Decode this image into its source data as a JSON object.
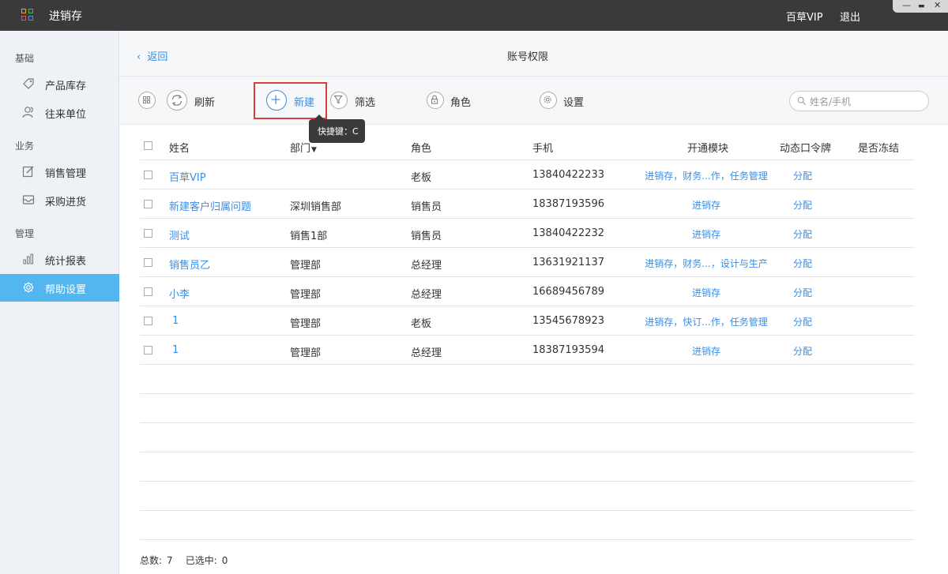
{
  "window": {
    "app_title": "进销存",
    "user": "百草VIP",
    "logout": "退出",
    "controls": {
      "minimize": "—",
      "maximize": "▬",
      "close": "✕"
    }
  },
  "sidebar": {
    "sections": [
      {
        "title": "基础",
        "items": [
          {
            "label": "产品库存",
            "icon": "tag-icon"
          },
          {
            "label": "往来单位",
            "icon": "contacts-icon"
          }
        ]
      },
      {
        "title": "业务",
        "items": [
          {
            "label": "销售管理",
            "icon": "edit-icon"
          },
          {
            "label": "采购进货",
            "icon": "inbox-icon"
          }
        ]
      },
      {
        "title": "管理",
        "items": [
          {
            "label": "统计报表",
            "icon": "bar-chart-icon"
          },
          {
            "label": "帮助设置",
            "icon": "gear-icon",
            "active": true
          }
        ]
      }
    ]
  },
  "header": {
    "back": "返回",
    "title": "账号权限"
  },
  "toolbar": {
    "refresh": "刷新",
    "create": "新建",
    "filter": "筛选",
    "role": "角色",
    "settings": "设置",
    "tooltip": "快捷键：C",
    "search_placeholder": "姓名/手机"
  },
  "table": {
    "headers": {
      "name": "姓名",
      "dept": "部门",
      "role": "角色",
      "phone": "手机",
      "modules": "开通模块",
      "token": "动态口令牌",
      "frozen": "是否冻结"
    },
    "sort_indicator": "▼",
    "rows": [
      {
        "name": "百草VIP",
        "dept": "",
        "role": "老板",
        "phone": "13840422233",
        "modules": "进销存，财务...作，任务管理",
        "token": "分配",
        "frozen": ""
      },
      {
        "name": "新建客户归属问题",
        "dept": "深圳销售部",
        "role": "销售员",
        "phone": "18387193596",
        "modules": "进销存",
        "token": "分配",
        "frozen": ""
      },
      {
        "name": "测试",
        "dept": "销售1部",
        "role": "销售员",
        "phone": "13840422232",
        "modules": "进销存",
        "token": "分配",
        "frozen": ""
      },
      {
        "name": "销售员乙",
        "dept": "管理部",
        "role": "总经理",
        "phone": "13631921137",
        "modules": "进销存，财务...，设计与生产",
        "token": "分配",
        "frozen": ""
      },
      {
        "name": "小李",
        "dept": "管理部",
        "role": "总经理",
        "phone": "16689456789",
        "modules": "进销存",
        "token": "分配",
        "frozen": ""
      },
      {
        "name": "1",
        "dept": "管理部",
        "role": "老板",
        "phone": "13545678923",
        "modules": "进销存，快订...作，任务管理",
        "token": "分配",
        "frozen": ""
      },
      {
        "name": "1",
        "dept": "管理部",
        "role": "总经理",
        "phone": "18387193594",
        "modules": "进销存",
        "token": "分配",
        "frozen": ""
      }
    ]
  },
  "footer": {
    "total_label": "总数:",
    "total": "7",
    "selected_label": "已选中:",
    "selected": "0"
  },
  "colors": {
    "accent": "#3a8ee6",
    "sidebar_active": "#54b6ee",
    "titlebar": "#3a3a3a",
    "highlight": "#e03a3a"
  }
}
